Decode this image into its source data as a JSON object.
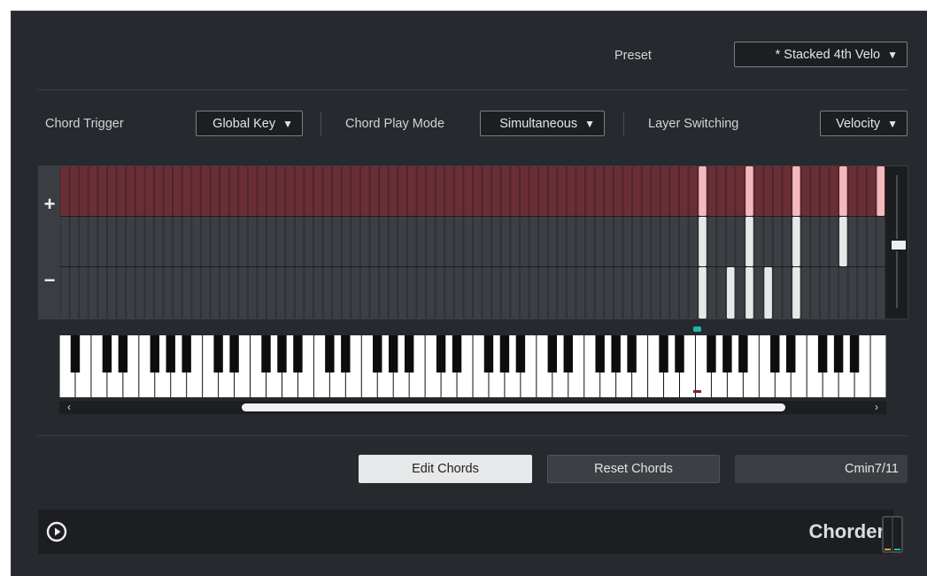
{
  "header": {
    "preset_label": "Preset",
    "preset_value": "* Stacked 4th Velo"
  },
  "controls": {
    "chord_trigger_label": "Chord Trigger",
    "chord_trigger_value": "Global Key",
    "play_mode_label": "Chord Play Mode",
    "play_mode_value": "Simultaneous",
    "layer_switching_label": "Layer Switching",
    "layer_switching_value": "Velocity",
    "dropdown_arrow": "▼"
  },
  "grid": {
    "add_label": "+",
    "remove_label": "−",
    "key_count": 88,
    "layers": [
      {
        "name": "layer-1",
        "notes": [
          68,
          73,
          78,
          83,
          87
        ]
      },
      {
        "name": "layer-2",
        "notes": [
          68,
          73,
          78,
          83
        ]
      },
      {
        "name": "layer-3",
        "notes": [
          68,
          71,
          73,
          75,
          78
        ]
      }
    ]
  },
  "keyboard": {
    "root_note_index": 68,
    "pressed_note_index": 68
  },
  "scrollbar": {
    "left_arrow": "‹",
    "right_arrow": "›"
  },
  "actions": {
    "edit_chords": "Edit Chords",
    "reset_chords": "Reset Chords",
    "chord_name": "Cmin7/11"
  },
  "footer": {
    "brand": "Chorder"
  },
  "colors": {
    "accent_teal": "#1fb4b2",
    "layer_top_bg": "#4f262b",
    "note_active_top": "#f4b8bd",
    "note_active": "#e8e8e8",
    "meter_left": "#e0a32a",
    "meter_right": "#1fb4b2"
  }
}
